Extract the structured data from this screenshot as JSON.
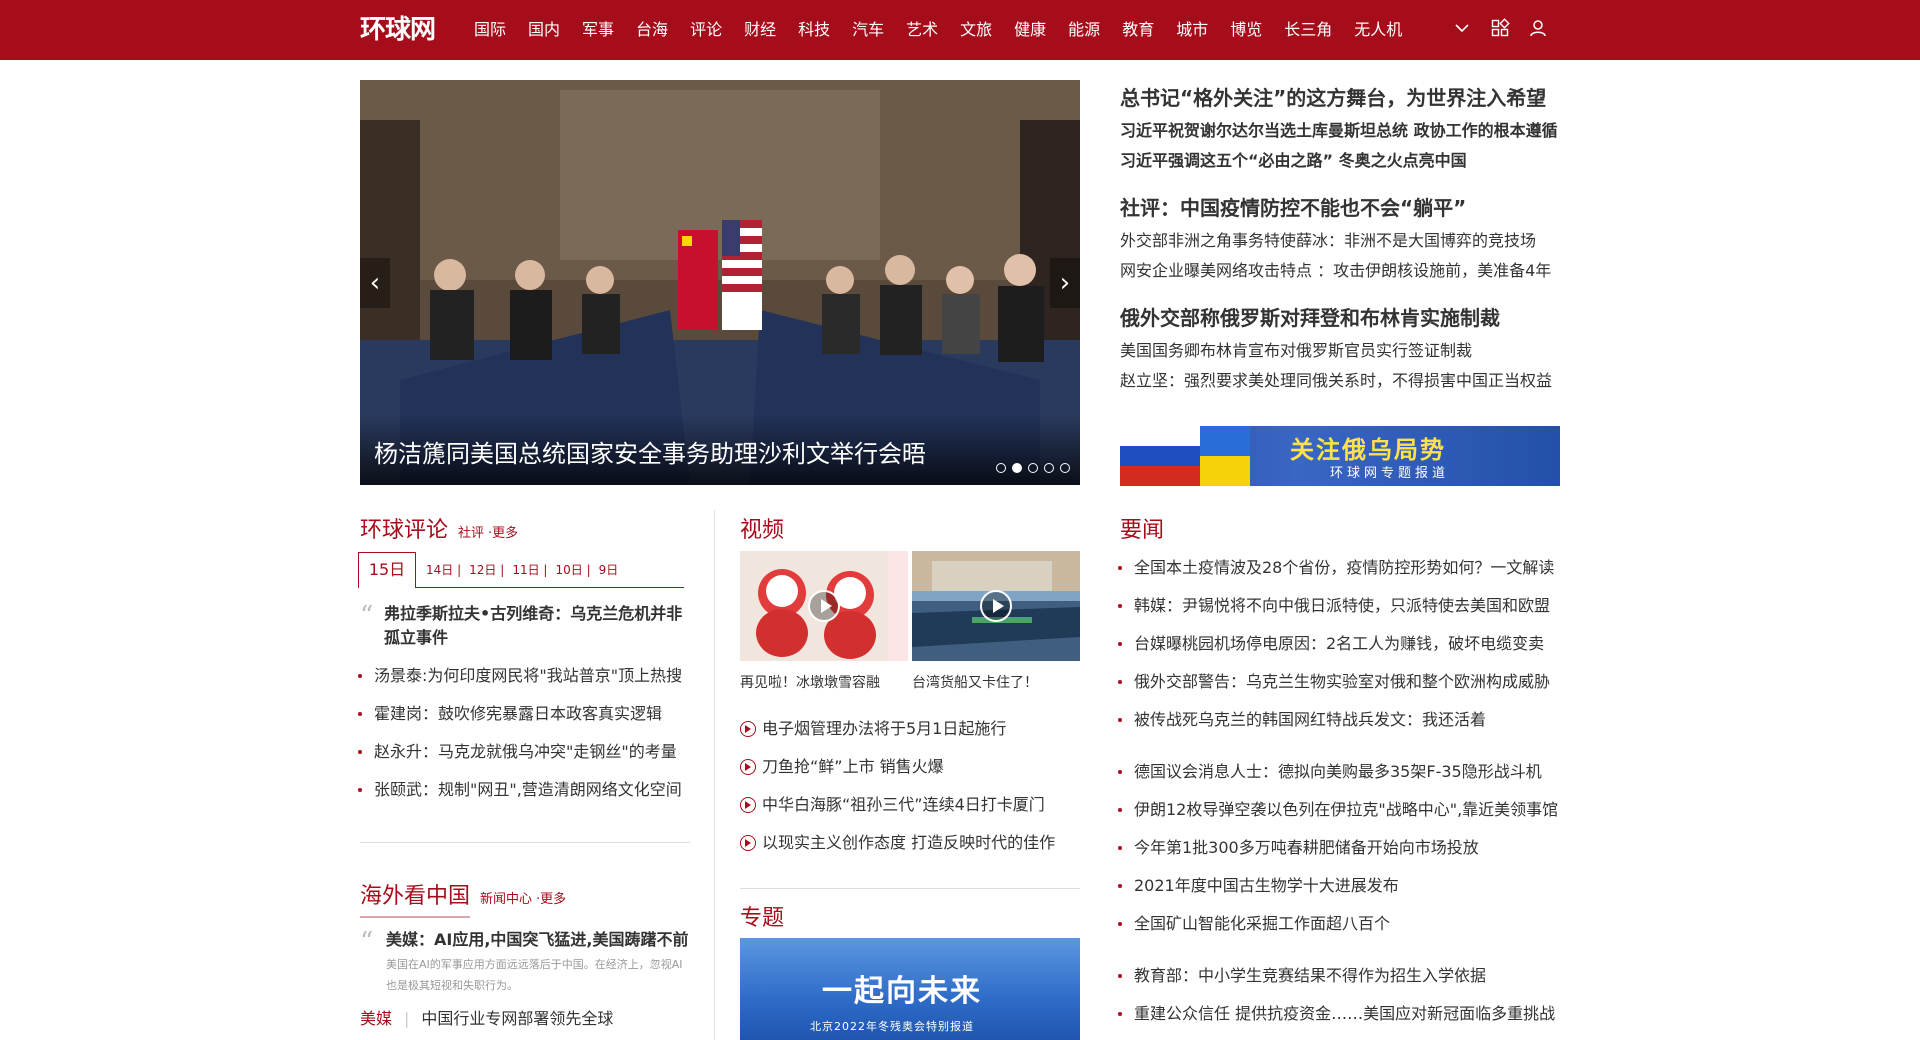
{
  "header": {
    "logo": "环球网",
    "nav": [
      "国际",
      "国内",
      "军事",
      "台海",
      "评论",
      "财经",
      "科技",
      "汽车",
      "艺术",
      "文旅",
      "健康",
      "能源",
      "教育",
      "城市",
      "博览",
      "长三角",
      "无人机"
    ],
    "icons": [
      "chevron-down-icon",
      "apps-grid-icon",
      "user-icon"
    ]
  },
  "slider": {
    "caption": "杨洁篪同美国总统国家安全事务助理沙利文举行会晤",
    "dot_count": 5,
    "active_dot": 1
  },
  "headlines": [
    {
      "title": "总书记“格外关注”的这方舞台，为世界注入希望",
      "subs": [
        "习近平祝贺谢尔达尔当选土库曼斯坦总统 政协工作的根本遵循",
        "习近平强调这五个“必由之路” 冬奥之火点亮中国"
      ],
      "bold_subs": true
    },
    {
      "title": "社评：中国疫情防控不能也不会“躺平”",
      "subs": [
        "外交部非洲之角事务特使薛冰：非洲不是大国博弈的竞技场",
        "网安企业曝美网络攻击特点 ：攻击伊朗核设施前，美准备4年"
      ],
      "bold_subs": false
    },
    {
      "title": "俄外交部称俄罗斯对拜登和布林肯实施制裁",
      "subs": [
        "美国国务卿布林肯宣布对俄罗斯官员实行签证制裁",
        "赵立坚：强烈要求美处理同俄关系时，不得损害中国正当权益"
      ],
      "bold_subs": false
    }
  ],
  "banner": {
    "title": "关注俄乌局势",
    "subtitle": "环球网专题报道"
  },
  "comment": {
    "heading": "环球评论",
    "links": [
      "社评",
      "更多"
    ],
    "dates": {
      "active": "15日",
      "others": [
        "14日",
        "12日",
        "11日",
        "10日",
        "9日"
      ],
      "separator": "|"
    },
    "quote": "弗拉季斯拉夫•古列维奇：乌克兰危机并非孤立事件",
    "items": [
      "汤景泰:为何印度网民将\"我站普京\"顶上热搜",
      "霍建岗：鼓吹修宪暴露日本政客真实逻辑",
      "赵永升：马克龙就俄乌冲突\"走钢丝\"的考量",
      "张颐武：规制\"网丑\",营造清朗网络文化空间"
    ]
  },
  "overseas": {
    "heading": "海外看中国",
    "links": [
      "新闻中心",
      "更多"
    ],
    "quote": "美媒：AI应用,中国突飞猛进,美国踌躇不前",
    "desc": "美国在AI的军事应用方面远远落后于中国。在经济上，忽视AI也是极其短视和失职行为。",
    "line_tag": "美媒",
    "line_text": "中国行业专网部署领先全球"
  },
  "video": {
    "heading": "视频",
    "thumbs": [
      {
        "caption": "再见啦！冰墩墩雪容融"
      },
      {
        "caption": "台湾货船又卡住了！"
      }
    ],
    "items": [
      "电子烟管理办法将于5月1日起施行",
      "刀鱼抢“鲜”上市 销售火爆",
      "中华白海豚“祖孙三代”连续4日打卡厦门",
      "以现实主义创作态度 打造反映时代的佳作"
    ]
  },
  "topic": {
    "heading": "专题",
    "title": "一起向未来",
    "subtitle": "北京2022年冬残奥会特别报道"
  },
  "news": {
    "heading": "要闻",
    "group1": [
      "全国本土疫情波及28个省份，疫情防控形势如何？一文解读",
      "韩媒：尹锡悦将不向中俄日派特使，只派特使去美国和欧盟",
      "台媒曝桃园机场停电原因：2名工人为赚钱，破坏电缆变卖",
      "俄外交部警告：乌克兰生物实验室对俄和整个欧洲构成威胁",
      "被传战死乌克兰的韩国网红特战兵发文：我还活着"
    ],
    "group2": [
      "德国议会消息人士：德拟向美购最多35架F-35隐形战斗机",
      "伊朗12枚导弹空袭以色列在伊拉克\"战略中心\",靠近美领事馆",
      "今年第1批300多万吨春耕肥储备开始向市场投放",
      "2021年度中国古生物学十大进展发布",
      "全国矿山智能化采掘工作面超八百个"
    ],
    "group3": [
      "教育部：中小学生竞赛结果不得作为招生入学依据",
      "重建公众信任 提供抗疫资金……美国应对新冠面临多重挑战"
    ]
  },
  "colors": {
    "brand": "#a50d1b"
  }
}
